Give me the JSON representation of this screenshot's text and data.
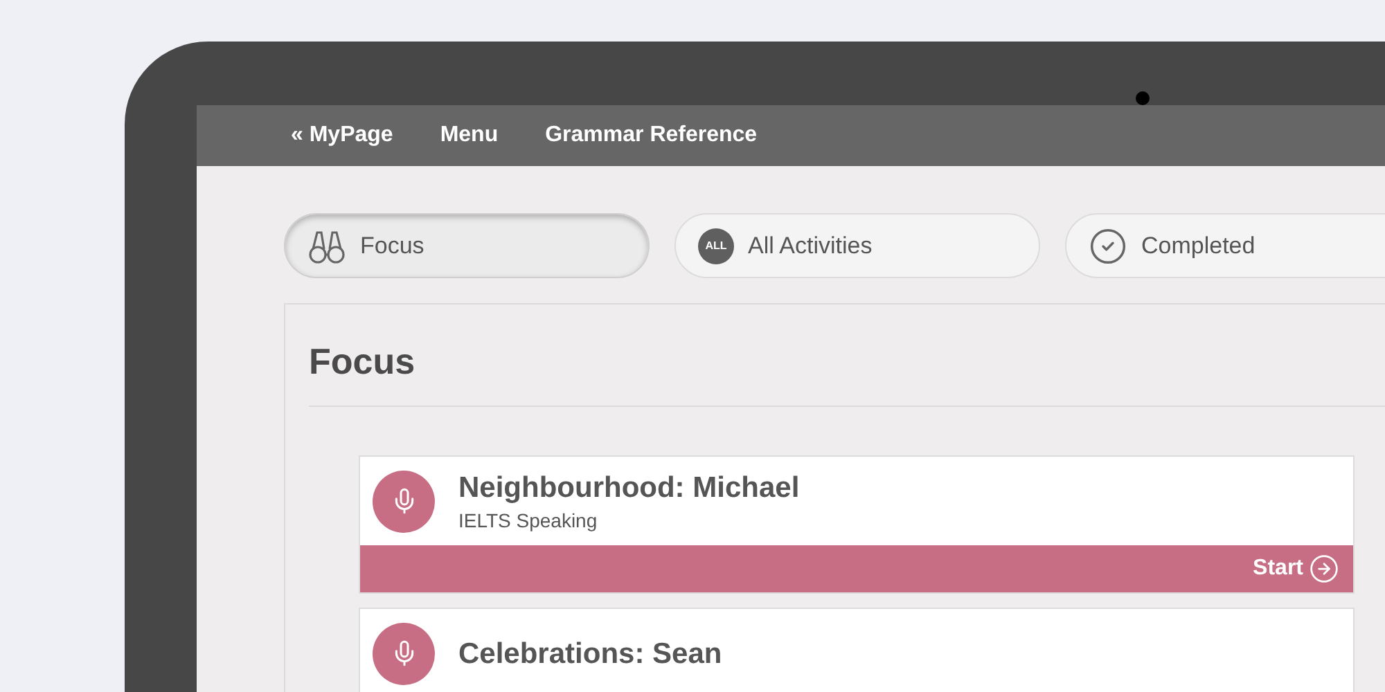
{
  "nav_links": [
    {
      "label": "« MyPage"
    },
    {
      "label": "Menu"
    },
    {
      "label": "Grammar Reference"
    }
  ],
  "filter_tabs": [
    {
      "label": "Focus",
      "selected": true,
      "kind": "binoculars"
    },
    {
      "label": "All Activities",
      "selected": false,
      "kind": "badge",
      "badge": "ALL"
    },
    {
      "label": "Completed",
      "selected": false,
      "kind": "check"
    }
  ],
  "section": {
    "title": "Focus"
  },
  "activities": [
    {
      "title": "Neighbourhood: Michael",
      "subtitle": "IELTS Speaking",
      "action": "Start"
    },
    {
      "title": "Celebrations: Sean"
    }
  ]
}
